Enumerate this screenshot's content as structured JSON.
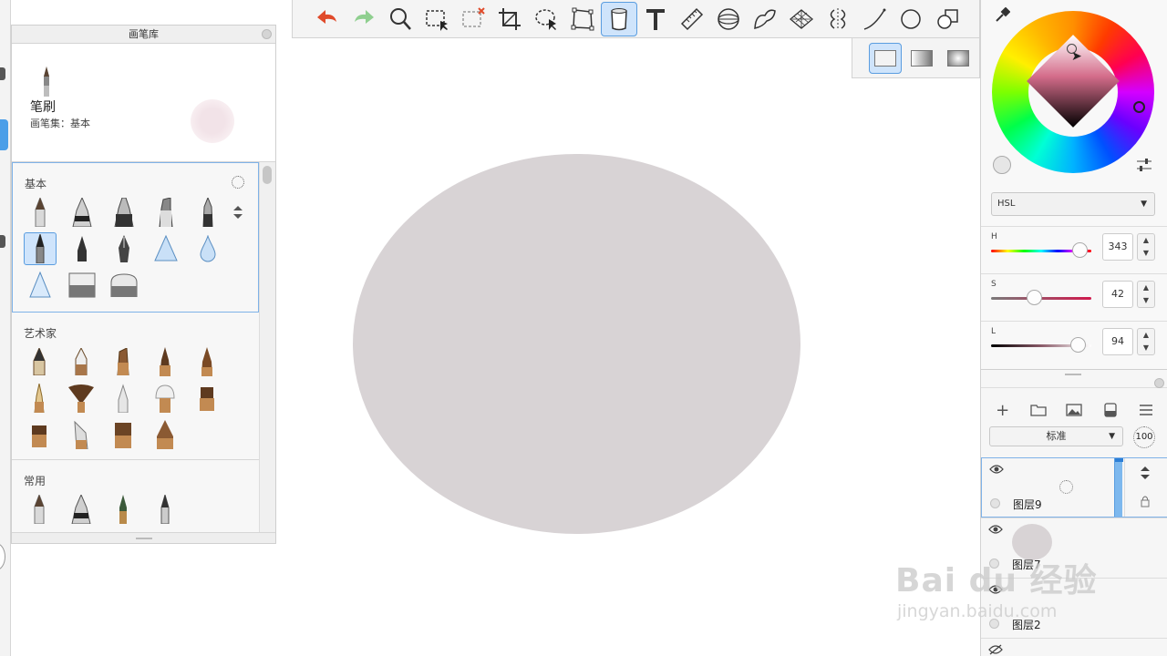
{
  "brush_library": {
    "title": "画笔库",
    "preview": {
      "name": "笔刷",
      "set": "画笔集：基本"
    },
    "sections": [
      {
        "title": "基本"
      },
      {
        "title": "艺术家"
      },
      {
        "title": "常用"
      }
    ]
  },
  "toolbar": {
    "tools": [
      "undo-icon",
      "redo-icon",
      "zoom-icon",
      "rect-select-icon",
      "clear-select-icon",
      "crop-icon",
      "lasso-icon",
      "transform-icon",
      "fill-bucket-icon",
      "text-icon",
      "ruler-icon",
      "ellipse-guide-icon",
      "french-curve-icon",
      "perspective-icon",
      "symmetry-icon",
      "stroke-icon",
      "circle-icon",
      "shape-icon"
    ],
    "selected_tool": "fill-bucket-icon",
    "fill_types": [
      "solid-fill-icon",
      "linear-gradient-icon",
      "radial-gradient-icon"
    ]
  },
  "color": {
    "mode": "HSL",
    "sliders": [
      {
        "label": "H",
        "value": "343"
      },
      {
        "label": "S",
        "value": "42"
      },
      {
        "label": "L",
        "value": "94"
      }
    ],
    "current_hex": "#f2e6e9",
    "fill_hex": "#d8d3d5"
  },
  "layers": {
    "blend_mode": "标准",
    "opacity": "100",
    "items": [
      {
        "name": "图层9"
      },
      {
        "name": "图层7"
      },
      {
        "name": "图层2"
      }
    ]
  },
  "watermark": {
    "line1": "Bai du 经验",
    "line2": "jingyan.baidu.com"
  }
}
